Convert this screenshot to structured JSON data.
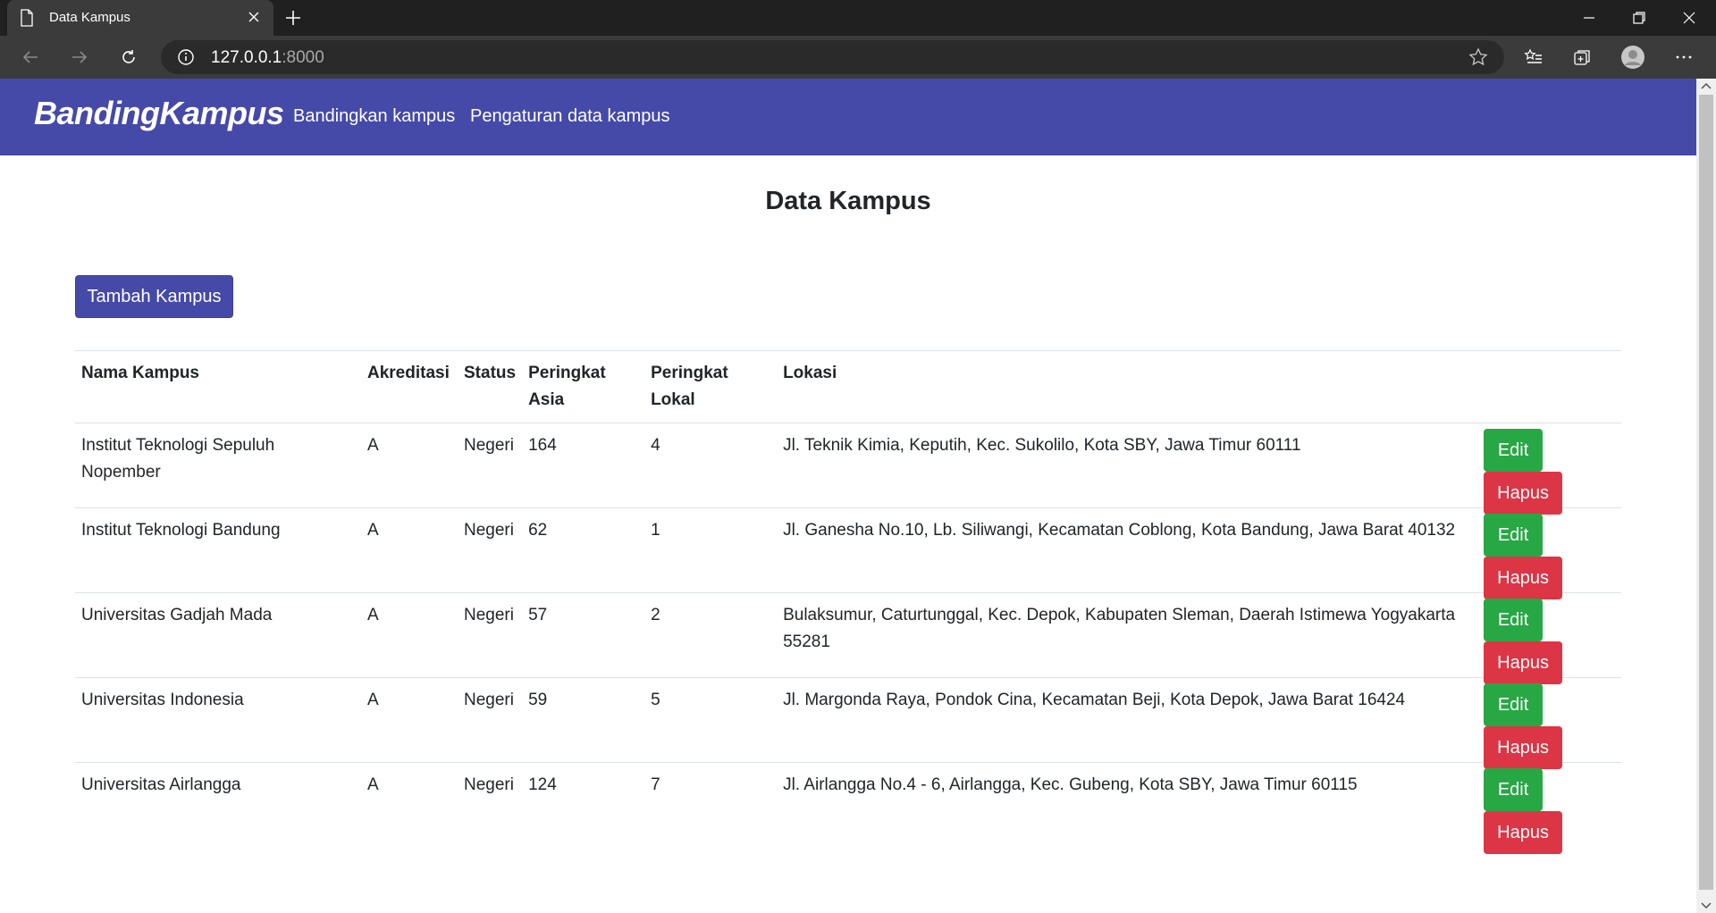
{
  "browser": {
    "tab_title": "Data Kampus",
    "url_host": "127.0.0.1",
    "url_port": ":8000"
  },
  "navbar": {
    "brand": "BandingKampus",
    "links": [
      "Bandingkan kampus",
      "Pengaturan data kampus"
    ]
  },
  "page": {
    "title": "Data Kampus",
    "add_button": "Tambah Kampus"
  },
  "table": {
    "headers": {
      "nama": "Nama Kampus",
      "akreditasi": "Akreditasi",
      "status": "Status",
      "asia": "Peringkat Asia",
      "lokal": "Peringkat Lokal",
      "lokasi": "Lokasi"
    },
    "edit_label": "Edit",
    "delete_label": "Hapus",
    "rows": [
      {
        "nama": "Institut Teknologi Sepuluh Nopember",
        "akreditasi": "A",
        "status": "Negeri",
        "asia": "164",
        "lokal": "4",
        "lokasi": "Jl. Teknik Kimia, Keputih, Kec. Sukolilo, Kota SBY, Jawa Timur 60111"
      },
      {
        "nama": "Institut Teknologi Bandung",
        "akreditasi": "A",
        "status": "Negeri",
        "asia": "62",
        "lokal": "1",
        "lokasi": "Jl. Ganesha No.10, Lb. Siliwangi, Kecamatan Coblong, Kota Bandung, Jawa Barat 40132"
      },
      {
        "nama": "Universitas Gadjah Mada",
        "akreditasi": "A",
        "status": "Negeri",
        "asia": "57",
        "lokal": "2",
        "lokasi": "Bulaksumur, Caturtunggal, Kec. Depok, Kabupaten Sleman, Daerah Istimewa Yogyakarta 55281"
      },
      {
        "nama": "Universitas Indonesia",
        "akreditasi": "A",
        "status": "Negeri",
        "asia": "59",
        "lokal": "5",
        "lokasi": "Jl. Margonda Raya, Pondok Cina, Kecamatan Beji, Kota Depok, Jawa Barat 16424"
      },
      {
        "nama": "Universitas Airlangga",
        "akreditasi": "A",
        "status": "Negeri",
        "asia": "124",
        "lokal": "7",
        "lokasi": "Jl. Airlangga No.4 - 6, Airlangga, Kec. Gubeng, Kota SBY, Jawa Timur 60115"
      }
    ]
  },
  "colors": {
    "brand": "#4549a8",
    "edit": "#28a745",
    "delete": "#dc3545"
  }
}
